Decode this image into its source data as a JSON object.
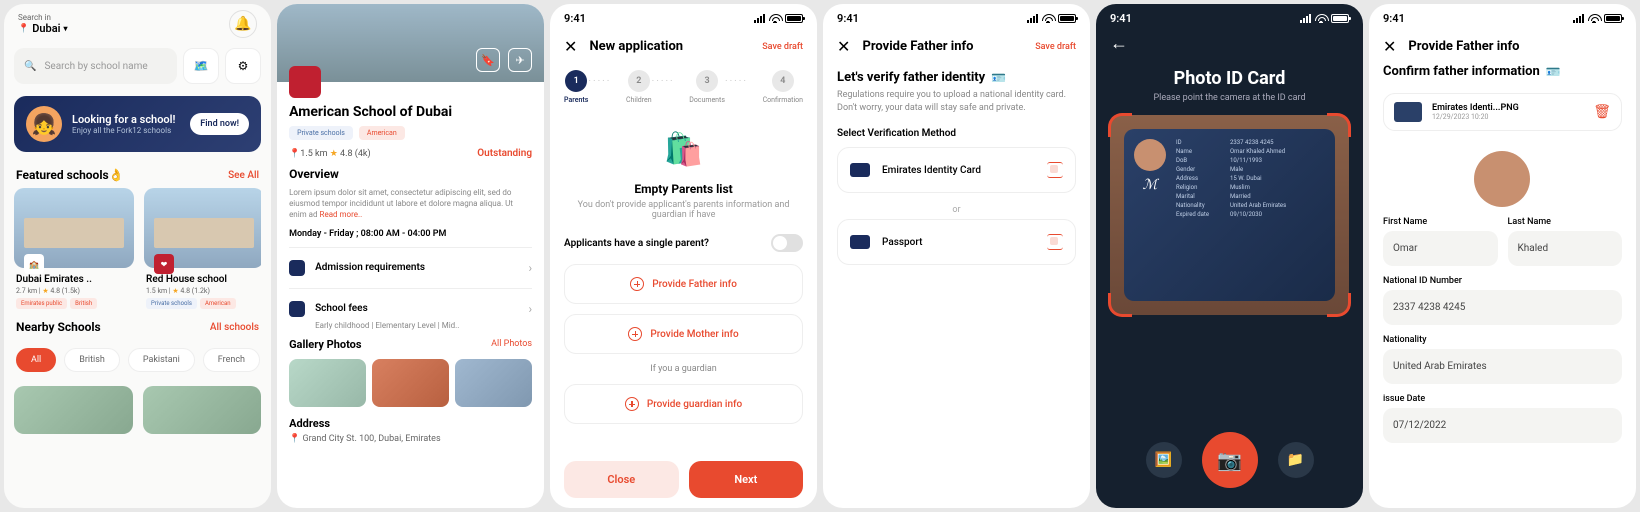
{
  "status": {
    "time": "9:41"
  },
  "s1": {
    "searchIn": "Search in",
    "location": "Dubai",
    "searchPlaceholder": "Search by school name",
    "banner": {
      "title": "Looking for a school!",
      "sub": "Enjoy all the Fork12 schools",
      "cta": "Find now!"
    },
    "featured": {
      "title": "Featured schools👌",
      "seeAll": "See All",
      "cards": [
        {
          "name": "Dubai Emirates ..",
          "dist": "2.7 km",
          "rating": "4.8 (1.5k)",
          "tags": [
            "Emirates public",
            "British"
          ]
        },
        {
          "name": "Red House school",
          "dist": "1.5 km",
          "rating": "4.8 (1.2k)",
          "tags": [
            "Private schools",
            "American"
          ]
        }
      ]
    },
    "nearby": {
      "title": "Nearby Schools",
      "all": "All schools"
    },
    "chips": [
      "All",
      "British",
      "Pakistani",
      "French"
    ]
  },
  "s2": {
    "name": "American School of Dubai",
    "tags": [
      "Private schools",
      "American"
    ],
    "dist": "1.5 km",
    "rating": "4.8 (4k)",
    "badge": "Outstanding",
    "overviewTitle": "Overview",
    "overview": "Lorem ipsum dolor sit amet, consectetur adipiscing elit, sed do eiusmod tempor incididunt ut labore et dolore magna aliqua. Ut enim ad ",
    "readMore": "Read more..",
    "hours": "Monday - Friday ; 08:00 AM - 04:00 PM",
    "rows": {
      "req": "Admission requirements",
      "fees": "School fees"
    },
    "levels": "Early childhood   |   Elementary Level   |   Mid..",
    "galleryTitle": "Gallery Photos",
    "allPhotos": "All Photos",
    "addressTitle": "Address",
    "address": "Grand City St. 100, Dubai, Emirates"
  },
  "s3": {
    "title": "New application",
    "save": "Save draft",
    "steps": [
      "Parents",
      "Children",
      "Documents",
      "Confirmation"
    ],
    "emptyTitle": "Empty Parents list",
    "emptySub": "You don't provide applicant's parents information and guardian if have",
    "question": "Applicants have a single parent?",
    "actions": {
      "father": "Provide Father info",
      "mother": "Provide Mother info",
      "guardian": "Provide guardian info"
    },
    "guardianTxt": "If you a guardian",
    "close": "Close",
    "next": "Next"
  },
  "s4": {
    "title": "Provide Father info",
    "save": "Save draft",
    "h1": "Let's verify father identity",
    "desc": "Regulations require you to upload a national identity card. Don't worry, your data will stay safe and private.",
    "secTitle": "Select Verification Method",
    "methods": {
      "eid": "Emirates Identity Card",
      "passport": "Passport"
    },
    "or": "or"
  },
  "s5": {
    "title": "Photo ID Card",
    "sub": "Please point the camera at the ID card",
    "card": {
      "id": "2337 4238 4245",
      "name": "Omar Khaled Ahmed",
      "dob": "10/11/1993",
      "gender": "Male",
      "address": "15 W. Dubai",
      "religion": "Muslim",
      "marital": "Married",
      "nationality": "United Arab Emirates",
      "expired": "09/10/2030"
    },
    "labels": {
      "id": "ID",
      "name": "Name",
      "dob": "DoB",
      "gender": "Gender",
      "address": "Address",
      "religion": "Religion",
      "marital": "Marital",
      "nationality": "Nationality",
      "expired": "Expired date"
    }
  },
  "s6": {
    "title": "Provide Father info",
    "h1": "Confirm father information",
    "file": {
      "name": "Emirates Identi...PNG",
      "date": "12/29/2023",
      "time": "10:20"
    },
    "labels": {
      "first": "First Name",
      "last": "Last Name",
      "nid": "National ID Number",
      "nat": "Nationality",
      "issue": "issue Date"
    },
    "values": {
      "first": "Omar",
      "last": "Khaled",
      "nid": "2337 4238 4245",
      "nat": "United Arab Emirates",
      "issue": "07/12/2022"
    }
  }
}
